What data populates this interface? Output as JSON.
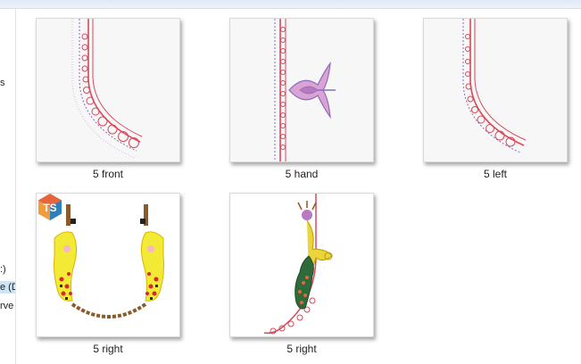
{
  "nav_fragments": [
    ":)",
    "e (D",
    "rve"
  ],
  "nav_partial_top": "s",
  "files": [
    {
      "name": "5 front"
    },
    {
      "name": "5 hand"
    },
    {
      "name": "5 left"
    },
    {
      "name": "5 right"
    },
    {
      "name": "5 right"
    }
  ],
  "badge": {
    "text": "TS",
    "colors": [
      "#e8643c",
      "#3fa7d6",
      "#2f80b8",
      "#f29b3a"
    ]
  },
  "colors": {
    "stitch_red": "#d9485a",
    "stitch_purple": "#8c6bb8",
    "gold": "#e8d23c",
    "chain_brown": "#8b5a2b"
  }
}
